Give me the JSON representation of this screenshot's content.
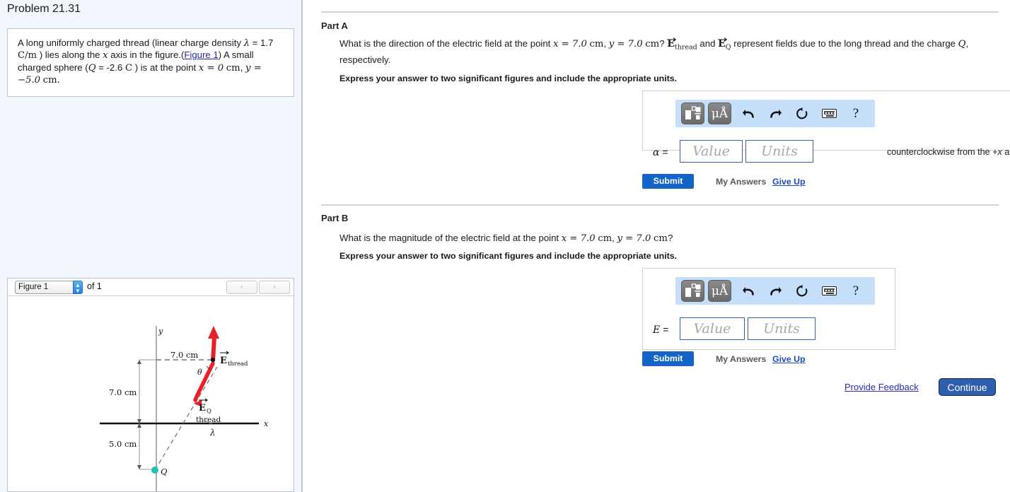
{
  "problem": {
    "title": "Problem 21.31",
    "statement_parts": {
      "p1": "A long uniformly charged thread (linear charge density ",
      "lambda": "λ",
      "p2": " = 1.7 ",
      "cperm": "C/m",
      "p3": " ) lies along the ",
      "x1": "x",
      "p4": " axis in the figure.(",
      "figure_link": "Figure 1",
      "p5": ") A small charged sphere (",
      "Q": "Q",
      "p6": " = -2.6 ",
      "Cunit": "C",
      "p7": " ) is at the point ",
      "x_eq": "x = 0",
      "cm1": "cm",
      "comma": ",",
      "y_eq": "y = −5.0",
      "cm2": "cm",
      "period": "."
    }
  },
  "figure_panel": {
    "select_value": "Figure 1",
    "of_label": "of 1",
    "prev_label": "‹",
    "next_label": "›",
    "diagram": {
      "axis_x_label": "x",
      "axis_y_label": "y",
      "label_7cm_top": "7.0 cm",
      "label_7cm_left": "7.0 cm",
      "label_5cm_left": "5.0 cm",
      "label_E_thread": "E",
      "label_E_thread_sub": "thread",
      "label_E_Q": "E",
      "label_E_Q_sub": "Q",
      "label_thread": "thread",
      "label_lambda": "λ",
      "label_theta": "θ",
      "label_Q": "Q",
      "vector_color": "#e8202a",
      "charge_color": "#23c2ae"
    }
  },
  "partA": {
    "heading": "Part A",
    "question": {
      "t1": "What is the direction of the electric field at the point ",
      "x_val": "x = 7.0",
      "cm1": "cm",
      "comma": ", ",
      "y_val": "y = 7.0",
      "cm2": "cm",
      "q1": "? ",
      "E1": "E",
      "E1sub": "thread",
      "t2": " and ",
      "E2": "E",
      "E2sub": "Q",
      "t3": " represent fields due to the long thread and the charge ",
      "Qsym": "Q",
      "t4": ", respectively."
    },
    "express": "Express your answer to two significant figures and include the appropriate units.",
    "toolbar": {
      "template_label": "template-icon",
      "units_label": "μÅ",
      "undo_label": "←",
      "redo_label": "→",
      "reset_label": "↺",
      "keyboard_label": "keyboard-icon",
      "help_label": "?"
    },
    "answer": {
      "symbol": "α",
      "equals": "=",
      "value_placeholder": "Value",
      "units_placeholder": "Units",
      "value_current": "",
      "units_current": "",
      "suffix_pre": "counterclockwise from the +",
      "suffix_ital": "x",
      "suffix_post": " axis"
    },
    "submit_label": "Submit",
    "my_answers_label": "My Answers",
    "give_up_label": "Give Up"
  },
  "partB": {
    "heading": "Part B",
    "question": {
      "t1": "What is the magnitude of the electric field at the point ",
      "x_val": "x = 7.0",
      "cm1": "cm",
      "comma": ", ",
      "y_val": "y = 7.0",
      "cm2": "cm",
      "q1": "?"
    },
    "express": "Express your answer to two significant figures and include the appropriate units.",
    "toolbar": {
      "units_label": "μÅ",
      "help_label": "?"
    },
    "answer": {
      "symbol": "E",
      "equals": "=",
      "value_placeholder": "Value",
      "units_placeholder": "Units",
      "value_current": "",
      "units_current": ""
    },
    "submit_label": "Submit",
    "my_answers_label": "My Answers",
    "give_up_label": "Give Up"
  },
  "footer": {
    "provide_feedback": "Provide Feedback",
    "continue_label": "Continue"
  },
  "colors": {
    "submit_blue": "#1463c6",
    "continue_blue": "#2d5fad",
    "link_blue": "#2a2ab0",
    "toolbar_blue": "#c5dffa",
    "panel_bg": "#f2f7fd",
    "vector_red": "#e8202a",
    "charge_teal": "#23c2ae"
  }
}
